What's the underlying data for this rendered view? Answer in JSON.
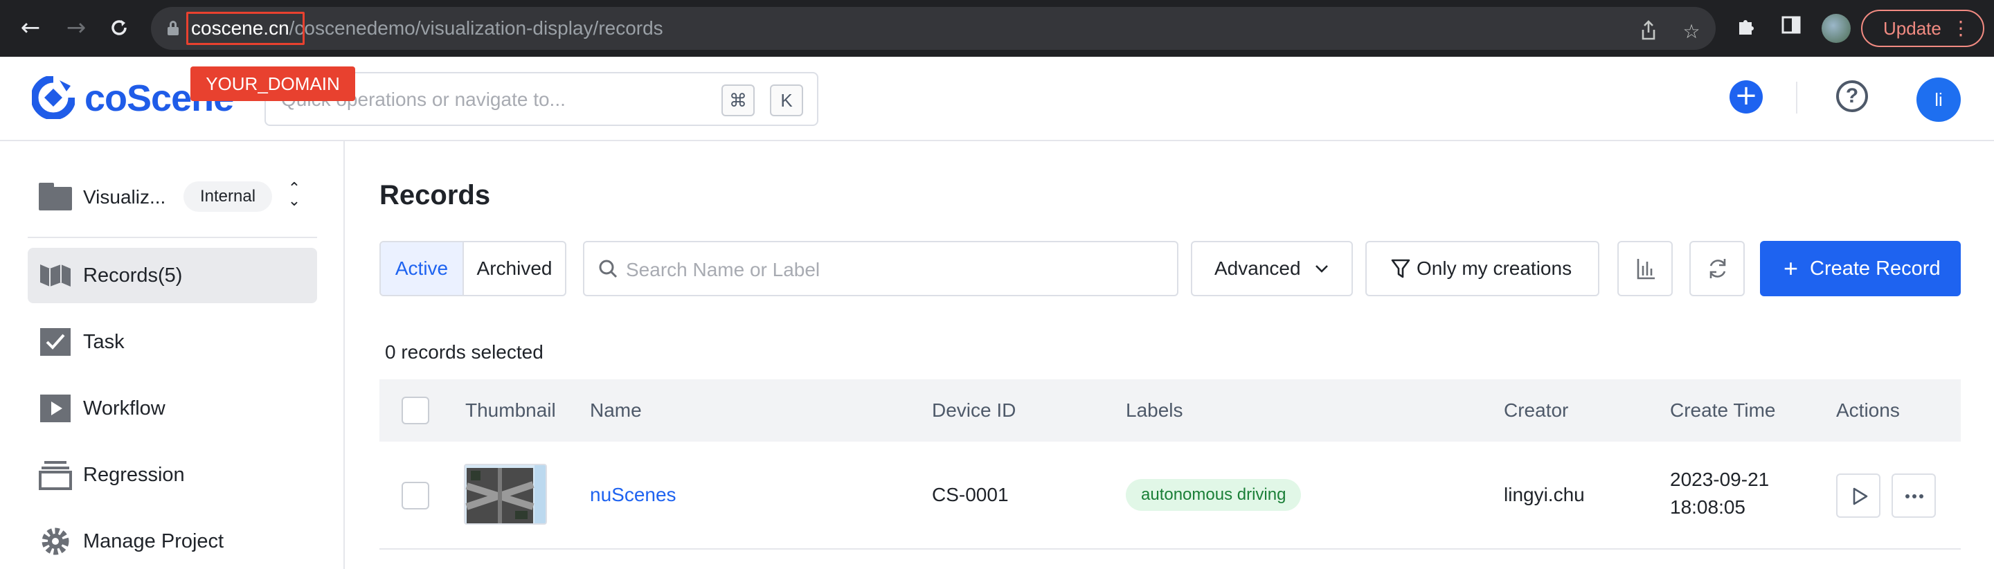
{
  "browser": {
    "url_domain": "coscene.cn",
    "url_path": "/coscenedemo/visualization-display/records",
    "annotation": "YOUR_DOMAIN",
    "update_label": "Update"
  },
  "header": {
    "logo_text": "coScene",
    "quick_placeholder": "Quick operations or navigate to...",
    "kbd_cmd": "⌘",
    "kbd_k": "K",
    "avatar_initials": "li"
  },
  "sidebar": {
    "project_name": "Visualiz...",
    "project_badge": "Internal",
    "items": [
      {
        "label": "Records(5)",
        "icon": "records-icon",
        "active": true
      },
      {
        "label": "Task",
        "icon": "task-icon",
        "active": false
      },
      {
        "label": "Workflow",
        "icon": "workflow-icon",
        "active": false
      },
      {
        "label": "Regression",
        "icon": "regression-icon",
        "active": false
      },
      {
        "label": "Manage Project",
        "icon": "gear-icon",
        "active": false
      }
    ]
  },
  "main": {
    "title": "Records",
    "tabs": {
      "active": "Active",
      "archived": "Archived"
    },
    "search_placeholder": "Search Name or Label",
    "advanced_label": "Advanced",
    "only_mine_label": "Only my creations",
    "create_label": "Create Record",
    "selected_text": "0 records selected",
    "columns": [
      "Thumbnail",
      "Name",
      "Device ID",
      "Labels",
      "Creator",
      "Create Time",
      "Actions"
    ],
    "rows": [
      {
        "name": "nuScenes",
        "device_id": "CS-0001",
        "label": "autonomous driving",
        "creator": "lingyi.chu",
        "create_date": "2023-09-21",
        "create_time": "18:08:05"
      }
    ]
  },
  "colors": {
    "primary": "#1e63f0",
    "annotation_red": "#e8412f",
    "label_bg": "#e1f7e7",
    "label_text": "#1a7f37"
  }
}
